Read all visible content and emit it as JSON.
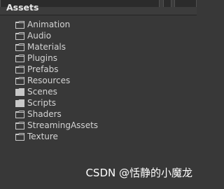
{
  "panel": {
    "title": "Assets"
  },
  "tree": {
    "items": [
      {
        "label": "Animation",
        "icon": "folder-outline-icon"
      },
      {
        "label": "Audio",
        "icon": "folder-outline-icon"
      },
      {
        "label": "Materials",
        "icon": "folder-outline-icon"
      },
      {
        "label": "Plugins",
        "icon": "folder-outline-icon"
      },
      {
        "label": "Prefabs",
        "icon": "folder-outline-icon"
      },
      {
        "label": "Resources",
        "icon": "folder-outline-icon"
      },
      {
        "label": "Scenes",
        "icon": "folder-filled-icon"
      },
      {
        "label": "Scripts",
        "icon": "folder-filled-icon"
      },
      {
        "label": "Shaders",
        "icon": "folder-outline-icon"
      },
      {
        "label": "StreamingAssets",
        "icon": "folder-outline-icon"
      },
      {
        "label": "Texture",
        "icon": "folder-outline-icon"
      }
    ]
  },
  "watermark": {
    "text": "CSDN @恬静的小魔龙"
  },
  "colors": {
    "panel_background": "#383838",
    "header_background": "#3c3c3c",
    "text": "#d4d4d4"
  }
}
